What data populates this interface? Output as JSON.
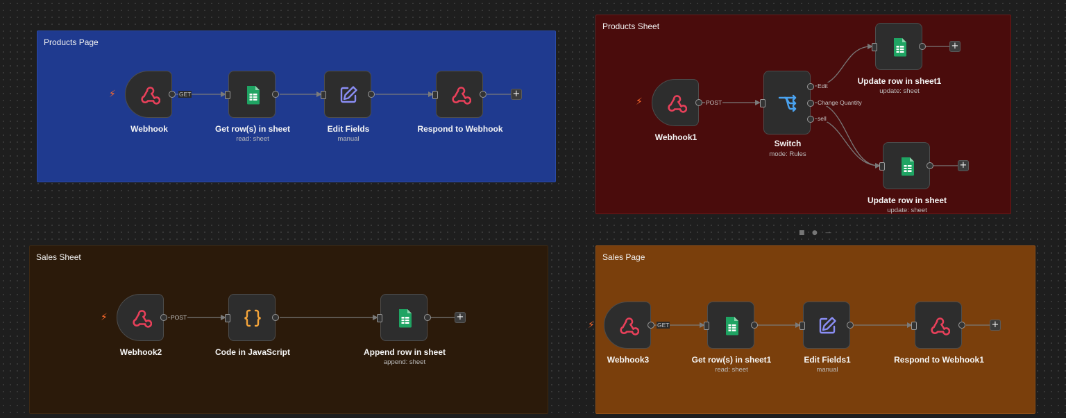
{
  "groups": {
    "products_page": {
      "title": "Products Page",
      "color": "#1f3a8f"
    },
    "products_sheet": {
      "title": "Products Sheet",
      "color": "#4a0c0c"
    },
    "sales_sheet": {
      "title": "Sales Sheet",
      "color": "#2b1a0a"
    },
    "sales_page": {
      "title": "Sales Page",
      "color": "#7a3f0c"
    }
  },
  "nodes": {
    "webhook": {
      "title": "Webhook",
      "icon": "webhook-icon"
    },
    "get_rows": {
      "title": "Get row(s) in sheet",
      "subtitle": "read: sheet",
      "icon": "google-sheets-icon"
    },
    "edit_fields": {
      "title": "Edit Fields",
      "subtitle": "manual",
      "icon": "edit-icon"
    },
    "respond": {
      "title": "Respond to Webhook",
      "icon": "webhook-icon"
    },
    "webhook1": {
      "title": "Webhook1",
      "icon": "webhook-icon"
    },
    "switch": {
      "title": "Switch",
      "subtitle": "mode: Rules",
      "icon": "switch-icon"
    },
    "update_row1": {
      "title": "Update row in sheet1",
      "subtitle": "update: sheet",
      "icon": "google-sheets-icon"
    },
    "update_row": {
      "title": "Update row in sheet",
      "subtitle": "update: sheet",
      "icon": "google-sheets-icon"
    },
    "webhook2": {
      "title": "Webhook2",
      "icon": "webhook-icon"
    },
    "code_js": {
      "title": "Code in JavaScript",
      "icon": "code-icon"
    },
    "append_row": {
      "title": "Append row in sheet",
      "subtitle": "append: sheet",
      "icon": "google-sheets-icon"
    },
    "webhook3": {
      "title": "Webhook3",
      "icon": "webhook-icon"
    },
    "get_rows1": {
      "title": "Get row(s) in sheet1",
      "subtitle": "read: sheet",
      "icon": "google-sheets-icon"
    },
    "edit_fields1": {
      "title": "Edit Fields1",
      "subtitle": "manual",
      "icon": "edit-icon"
    },
    "respond1": {
      "title": "Respond to Webhook1",
      "icon": "webhook-icon"
    }
  },
  "edge_labels": {
    "get": "GET",
    "post": "POST",
    "post2": "POST",
    "get2": "GET",
    "edit": "Edit",
    "change_quantity": "Change Quantity",
    "sell": "sell"
  },
  "plus_label": "+",
  "colors": {
    "webhook": "#e8405a",
    "sheets": "#1fa463",
    "edit": "#8b8ef5",
    "switch": "#4aa3f0",
    "code": "#f5a53a",
    "trigger": "#ff6a2b"
  }
}
